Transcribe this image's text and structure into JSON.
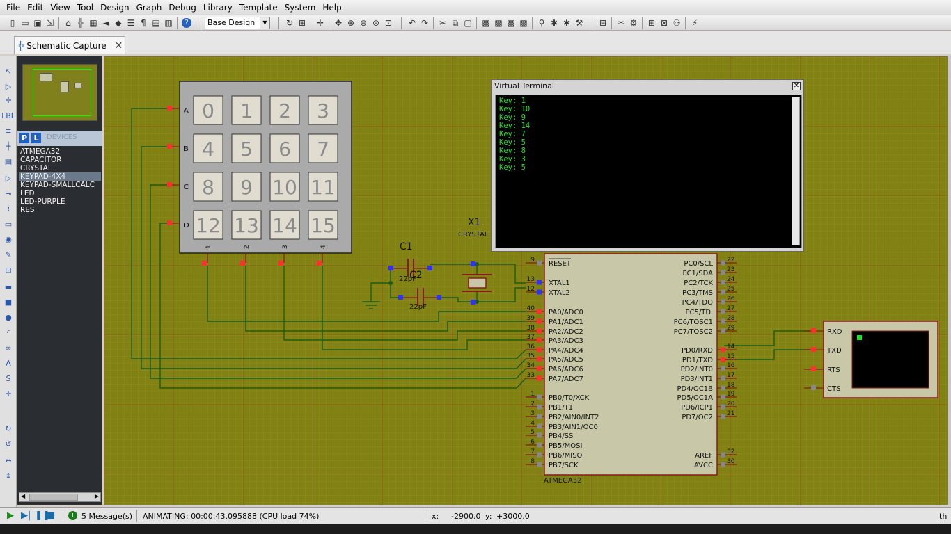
{
  "menu": [
    "File",
    "Edit",
    "View",
    "Tool",
    "Design",
    "Graph",
    "Debug",
    "Library",
    "Template",
    "System",
    "Help"
  ],
  "toolbar": {
    "design_select": "Base Design"
  },
  "tabs": [
    {
      "label": "Schematic Capture"
    }
  ],
  "pick_buttons": [
    "P",
    "L"
  ],
  "pick_header": "DEVICES",
  "devices": [
    "ATMEGA32",
    "CAPACITOR",
    "CRYSTAL",
    "KEYPAD-4X4",
    "KEYPAD-SMALLCALC",
    "LED",
    "LED-PURPLE",
    "RES"
  ],
  "selected_device": "KEYPAD-4X4",
  "virtual_terminal": {
    "title": "Virtual Terminal",
    "lines": [
      "Key: 1",
      "Key: 10",
      "Key: 9",
      "Key: 14",
      "Key: 7",
      "Key: 5",
      "Key: 8",
      "Key: 3",
      "Key: 5"
    ]
  },
  "keypad": {
    "rows": [
      "A",
      "B",
      "C",
      "D"
    ],
    "cols": [
      "1",
      "2",
      "3",
      "4"
    ],
    "keys": [
      "0",
      "1",
      "2",
      "3",
      "4",
      "5",
      "6",
      "7",
      "8",
      "9",
      "10",
      "11",
      "12",
      "13",
      "14",
      "15"
    ]
  },
  "components": {
    "c1_label": "C1",
    "c1_value": "22pF",
    "c2_label": "C2",
    "c2_value": "22pF",
    "x1_label": "X1",
    "x1_value": "CRYSTAL",
    "mcu_name": "ATMEGA32"
  },
  "mcu": {
    "left_pins": [
      {
        "num": "9",
        "name": "RESET"
      },
      {
        "num": "13",
        "name": "XTAL1"
      },
      {
        "num": "12",
        "name": "XTAL2"
      },
      {
        "num": "40",
        "name": "PA0/ADC0"
      },
      {
        "num": "39",
        "name": "PA1/ADC1"
      },
      {
        "num": "38",
        "name": "PA2/ADC2"
      },
      {
        "num": "37",
        "name": "PA3/ADC3"
      },
      {
        "num": "36",
        "name": "PA4/ADC4"
      },
      {
        "num": "35",
        "name": "PA5/ADC5"
      },
      {
        "num": "34",
        "name": "PA6/ADC6"
      },
      {
        "num": "33",
        "name": "PA7/ADC7"
      },
      {
        "num": "1",
        "name": "PB0/T0/XCK"
      },
      {
        "num": "2",
        "name": "PB1/T1"
      },
      {
        "num": "3",
        "name": "PB2/AIN0/INT2"
      },
      {
        "num": "4",
        "name": "PB3/AIN1/OC0"
      },
      {
        "num": "5",
        "name": "PB4/SS"
      },
      {
        "num": "6",
        "name": "PB5/MOSI"
      },
      {
        "num": "7",
        "name": "PB6/MISO"
      },
      {
        "num": "8",
        "name": "PB7/SCK"
      }
    ],
    "right_pins": [
      {
        "num": "22",
        "name": "PC0/SCL"
      },
      {
        "num": "23",
        "name": "PC1/SDA"
      },
      {
        "num": "24",
        "name": "PC2/TCK"
      },
      {
        "num": "25",
        "name": "PC3/TMS"
      },
      {
        "num": "26",
        "name": "PC4/TDO"
      },
      {
        "num": "27",
        "name": "PC5/TDI"
      },
      {
        "num": "28",
        "name": "PC6/TOSC1"
      },
      {
        "num": "29",
        "name": "PC7/TOSC2"
      },
      {
        "num": "14",
        "name": "PD0/RXD"
      },
      {
        "num": "15",
        "name": "PD1/TXD"
      },
      {
        "num": "16",
        "name": "PD2/INT0"
      },
      {
        "num": "17",
        "name": "PD3/INT1"
      },
      {
        "num": "18",
        "name": "PD4/OC1B"
      },
      {
        "num": "19",
        "name": "PD5/OC1A"
      },
      {
        "num": "20",
        "name": "PD6/ICP1"
      },
      {
        "num": "21",
        "name": "PD7/OC2"
      },
      {
        "num": "32",
        "name": "AREF"
      },
      {
        "num": "30",
        "name": "AVCC"
      }
    ]
  },
  "terminal_pins": [
    "RXD",
    "TXD",
    "RTS",
    "CTS"
  ],
  "status": {
    "messages": "5 Message(s)",
    "animating": "ANIMATING: 00:00:43.095888 (CPU load 74%)",
    "x_label": "x:",
    "x_value": "-2900.0",
    "y_label": "y:",
    "y_value": "+3000.0",
    "units": "th"
  },
  "colors": {
    "canvas_bg": "#828214",
    "wire": "#1a5c1a",
    "component_body": "#c8c8a8",
    "component_outline": "#8b1a1a",
    "pin_active": "#ff3030",
    "terminal_text": "#20e020"
  }
}
